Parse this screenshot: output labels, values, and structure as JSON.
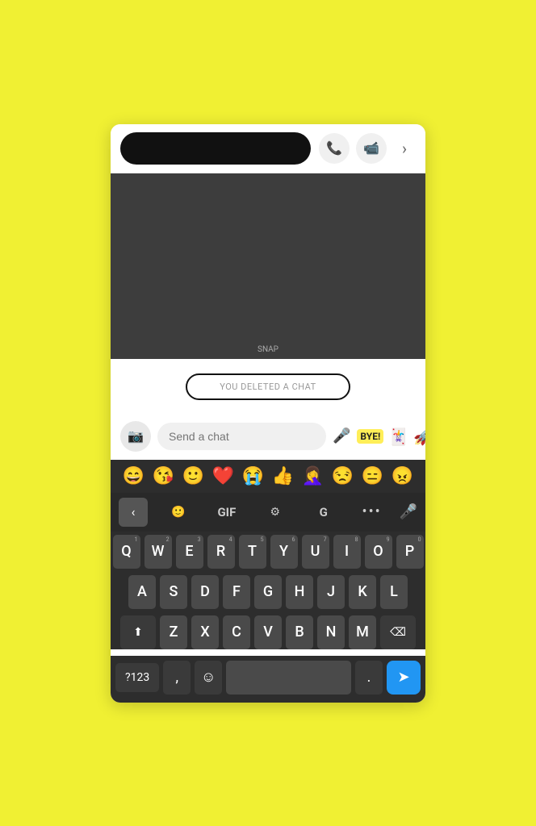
{
  "header": {
    "call_icon": "📞",
    "video_icon": "📹",
    "chevron_icon": "›"
  },
  "snap_area": {
    "label": "SNAP"
  },
  "deleted_chat": {
    "text": "YOU DELETED A CHAT"
  },
  "chat_input": {
    "placeholder": "Send a chat",
    "camera_icon": "📷",
    "mic_icon": "🎤",
    "bye_label": "BYE!",
    "sticker_icon": "🃏",
    "rocket_icon": "🚀"
  },
  "emoji_row": {
    "emojis": [
      "😄",
      "😘",
      "🙂",
      "❤️",
      "😭",
      "👍",
      "🤦‍♀️",
      "😒",
      "😑",
      "😠"
    ]
  },
  "keyboard": {
    "toolbar": {
      "back_icon": "‹",
      "sticker_icon": "🙂",
      "gif_label": "GIF",
      "settings_icon": "⚙",
      "translate_icon": "G",
      "dots_label": "...",
      "mic_icon": "🎤"
    },
    "row1": [
      "Q",
      "W",
      "E",
      "R",
      "T",
      "Y",
      "U",
      "I",
      "O",
      "P"
    ],
    "row1_nums": [
      "1",
      "2",
      "3",
      "4",
      "5",
      "6",
      "7",
      "8",
      "9",
      "0"
    ],
    "row2": [
      "A",
      "S",
      "D",
      "F",
      "G",
      "H",
      "J",
      "K",
      "L"
    ],
    "row3": [
      "Z",
      "X",
      "C",
      "V",
      "B",
      "N",
      "M"
    ],
    "shift_icon": "⬆",
    "backspace_icon": "⌫",
    "num_label": "?123",
    "comma_label": ",",
    "period_label": ".",
    "send_icon": "➤",
    "emoji_icon": "☺"
  }
}
